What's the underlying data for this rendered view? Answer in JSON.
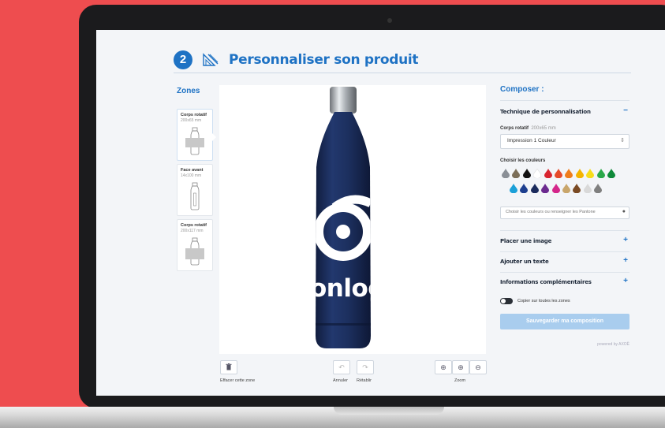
{
  "header": {
    "step_number": "2",
    "title": "Personnaliser son produit"
  },
  "zones": {
    "title": "Zones",
    "items": [
      {
        "name": "Corps rotatif",
        "size": "200x65 mm",
        "active": true
      },
      {
        "name": "Face avant",
        "size": "14x100 mm",
        "active": false
      },
      {
        "name": "Corps rotatif",
        "size": "200x117 mm",
        "active": false
      }
    ]
  },
  "canvas": {
    "logo_text": "monlogo"
  },
  "toolbar": {
    "delete_label": "Effacer cette zone",
    "undo_label": "Annuler",
    "redo_label": "Rétablir",
    "zoom_label": "Zoom"
  },
  "panel": {
    "title": "Composer :",
    "technique": {
      "title": "Technique de personnalisation",
      "toggle": "−",
      "zone_label": "Corps rotatif",
      "zone_size": "200x65 mm",
      "select_value": "Impression 1 Couleur",
      "colors_label": "Choisir les couleurs",
      "color_search_placeholder": "Choisir les couleurs ou renseigner les Pantone",
      "swatches_row1": [
        "#8a8f96",
        "#7b6e58",
        "#111111",
        "#ffffff",
        "#d8242f",
        "#e64a2a",
        "#ef7d1c",
        "#f4b400",
        "#f7dd1a",
        "#2aa84a",
        "#0f8a3a"
      ],
      "swatches_row2": [
        "#1ba0d8",
        "#1d3f8f",
        "#1a2a5c",
        "#6b2a8f",
        "#d4268a",
        "#c9a66b",
        "#7a4a24",
        "#d9d9d9",
        "#7f7f7f"
      ]
    },
    "sections": [
      {
        "title": "Placer une image",
        "toggle": "+"
      },
      {
        "title": "Ajouter un texte",
        "toggle": "+"
      },
      {
        "title": "Informations complémentaires",
        "toggle": "+"
      }
    ],
    "copy_toggle_label": "Copier sur toutes les zones",
    "save_label": "Sauvegarder ma composition",
    "powered_by": "powered by AXOË"
  },
  "colors": {
    "accent": "#1e72c4",
    "bottle": "#1c2f5e",
    "page_bg": "#EE4D4F"
  }
}
